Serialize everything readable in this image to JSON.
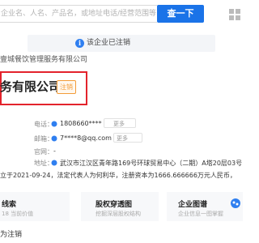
{
  "search": {
    "placeholder": "企业名、人名、产品名，或地址电话/经营范围等",
    "button_label": "查一下"
  },
  "notice": {
    "text": "该企业已注销"
  },
  "crumb": {
    "text": "壹城餐饮管理服务有限公司"
  },
  "company": {
    "name_visible": "务有限公司",
    "status": "注销"
  },
  "info": {
    "phone_label": "电话：",
    "phone_value": "1808660****",
    "phone_more": "更多",
    "email_label": "邮箱：",
    "email_value": "7****8@qq.com",
    "email_more": "更多",
    "website_label": "官网：",
    "website_value": "-",
    "address_label": "地址：",
    "address_value": "武汉市江汉区青年路169号环球贸易中心（二期）A塔20层03号"
  },
  "summary": {
    "text": "立于2021-09-24，法定代表人为何利华，注册资本为1666.666666万元人民币，"
  },
  "cards": [
    {
      "title": "线索",
      "sub": "18  当前价值"
    },
    {
      "title": "股权穿透图",
      "sub": "挖掘深层股权结构"
    },
    {
      "title": "企业图谱",
      "sub": "企业信息一图掌握"
    }
  ],
  "bottom": {
    "text": "为注销"
  },
  "colors": {
    "primary": "#1a73e8",
    "highlight_border": "#e3232c",
    "status_badge": "#f39c39"
  }
}
